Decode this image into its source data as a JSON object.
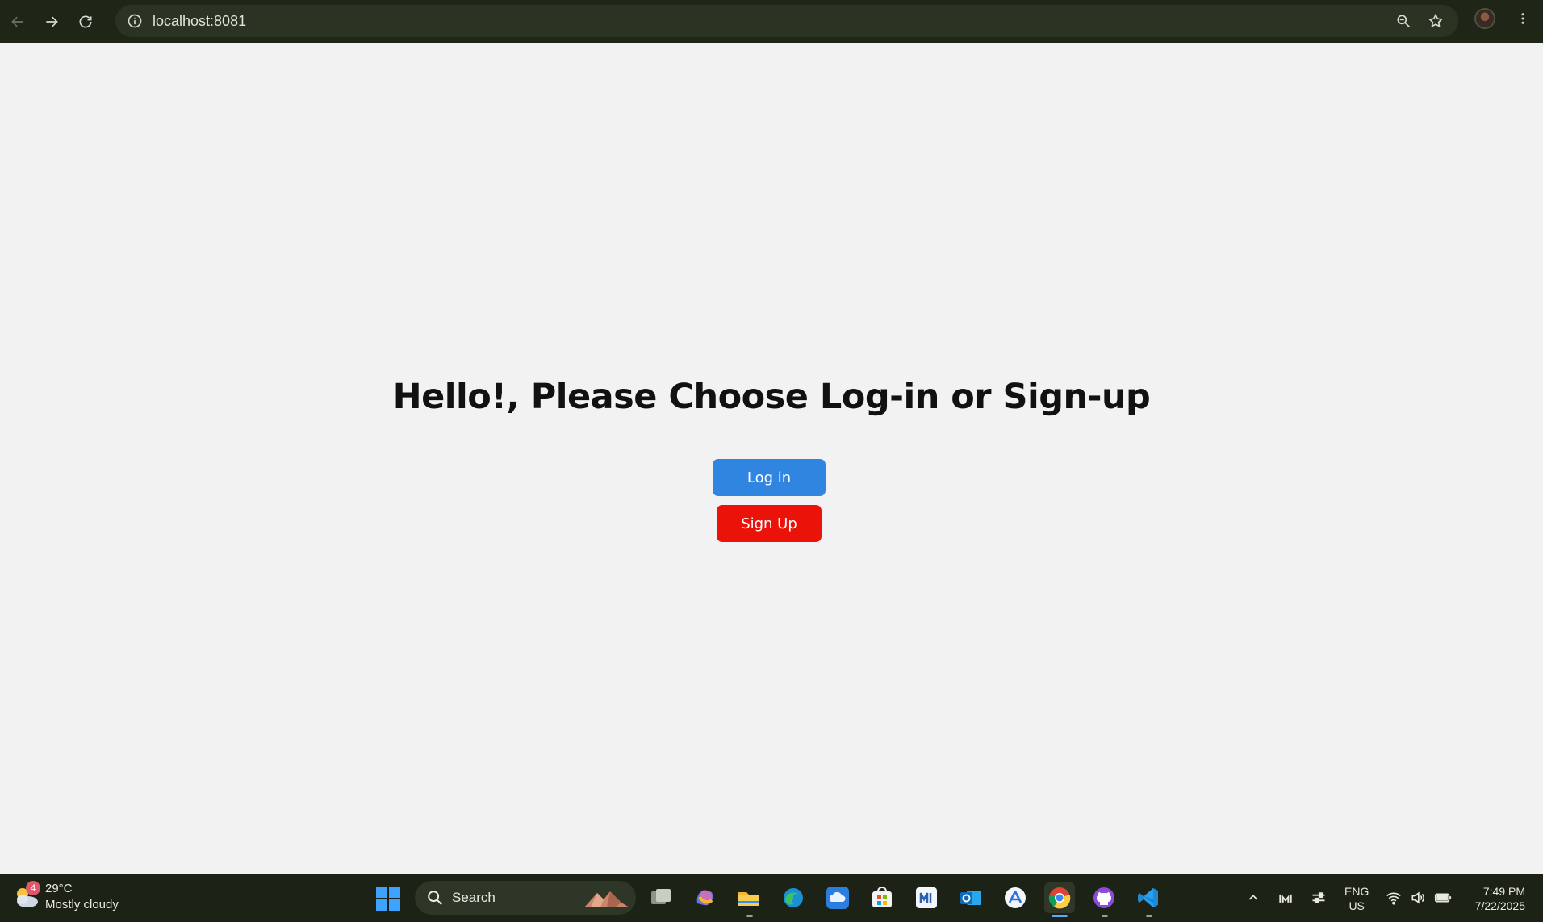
{
  "browser": {
    "url": "localhost:8081"
  },
  "page": {
    "heading": "Hello!, Please Choose Log-in or Sign-up",
    "login_label": "Log in",
    "signup_label": "Sign Up",
    "colors": {
      "login": "#2f85e0",
      "signup": "#ea1209"
    }
  },
  "taskbar": {
    "weather": {
      "temperature": "29°C",
      "condition": "Mostly cloudy",
      "badge": "4"
    },
    "search_label": "Search",
    "language": {
      "line1": "ENG",
      "line2": "US"
    },
    "clock": {
      "time": "7:49 PM",
      "date": "7/22/2025"
    },
    "apps": [
      "task-view-icon",
      "copilot-icon",
      "file-explorer-icon",
      "edge-icon",
      "onedrive-icon",
      "microsoft-store-icon",
      "app-icon",
      "outlook-icon",
      "app-store-icon",
      "chrome-icon",
      "github-desktop-icon",
      "vscode-icon"
    ]
  }
}
